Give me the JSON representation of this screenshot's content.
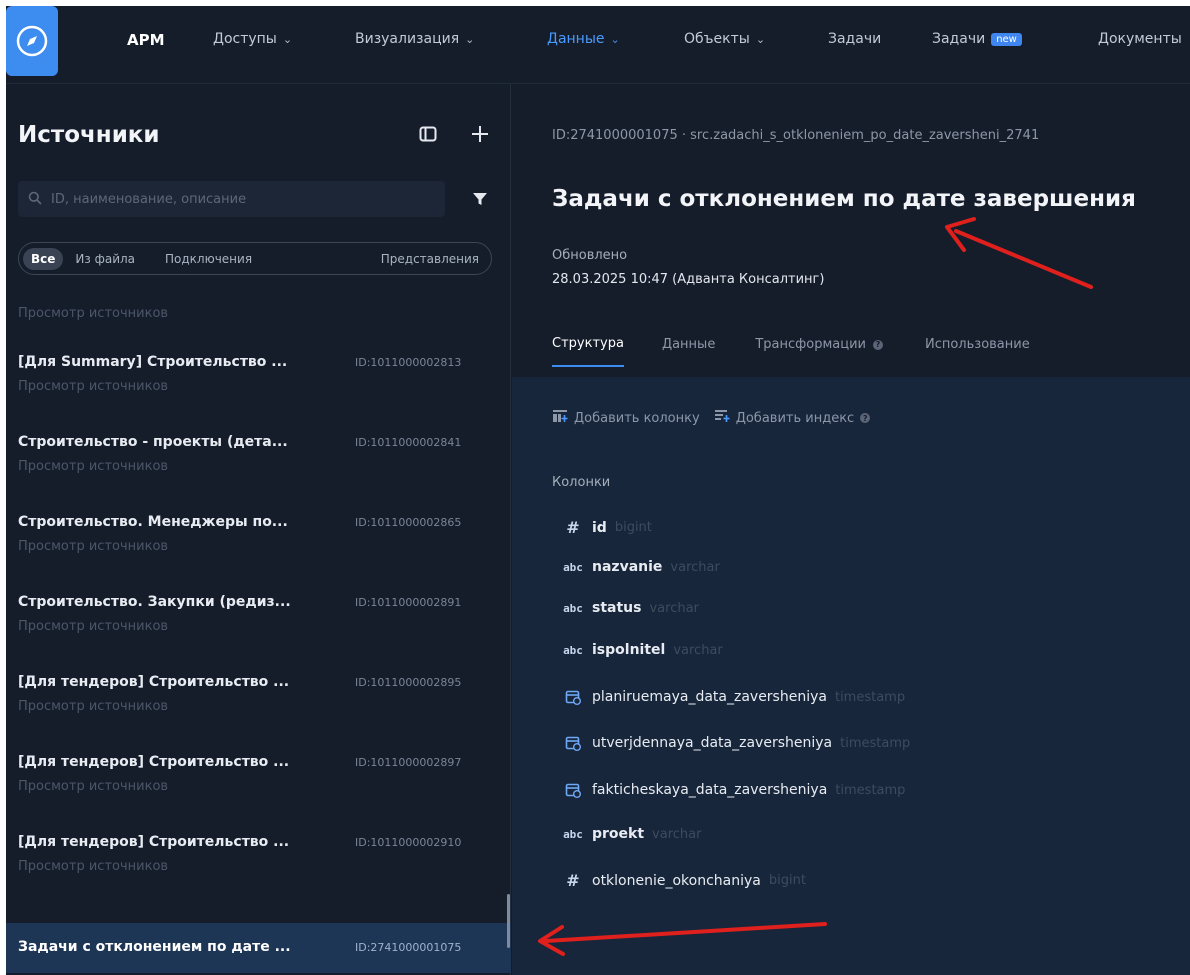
{
  "topnav": {
    "brand": "АРМ",
    "items": [
      {
        "label": "Доступы",
        "chevron": true
      },
      {
        "label": "Визуализация",
        "chevron": true
      },
      {
        "label": "Данные",
        "chevron": true,
        "active": true
      },
      {
        "label": "Объекты",
        "chevron": true
      },
      {
        "label": "Задачи"
      },
      {
        "label": "Задачи",
        "badge": "new"
      },
      {
        "label": "Документы"
      }
    ]
  },
  "sidebar": {
    "title": "Источники",
    "search_placeholder": "ID, наименование, описание",
    "segments": [
      "Все",
      "Из файла",
      "Подключения",
      "Представления"
    ],
    "active_segment": "Все",
    "top_sub": "Просмотр источников",
    "items": [
      {
        "name": "[Для Summary] Строительство ...",
        "id": "ID:1011000002813",
        "sub": "Просмотр источников"
      },
      {
        "name": "Строительство - проекты (дета...",
        "id": "ID:1011000002841",
        "sub": "Просмотр источников"
      },
      {
        "name": "Строительство. Менеджеры по...",
        "id": "ID:1011000002865",
        "sub": "Просмотр источников"
      },
      {
        "name": "Строительство. Закупки (редиз...",
        "id": "ID:1011000002891",
        "sub": "Просмотр источников"
      },
      {
        "name": "[Для тендеров] Строительство ...",
        "id": "ID:1011000002895",
        "sub": "Просмотр источников"
      },
      {
        "name": "[Для тендеров] Строительство ...",
        "id": "ID:1011000002897",
        "sub": "Просмотр источников"
      },
      {
        "name": "[Для тендеров] Строительство ...",
        "id": "ID:1011000002910",
        "sub": "Просмотр источников"
      }
    ],
    "selected": {
      "name": "Задачи с отклонением по дате ...",
      "id": "ID:2741000001075"
    }
  },
  "main": {
    "breadcrumb": "ID:2741000001075 · src.zadachi_s_otkloneniem_po_date_zaversheni_2741",
    "title": "Задачи с отклонением по дате завершения",
    "updated_label": "Обновлено",
    "updated_value": "28.03.2025 10:47 (Адванта Консалтинг)",
    "tabs": [
      {
        "label": "Структура",
        "active": true
      },
      {
        "label": "Данные"
      },
      {
        "label": "Трансформации",
        "help": true
      },
      {
        "label": "Использование"
      }
    ],
    "actions": [
      {
        "label": "Добавить колонку"
      },
      {
        "label": "Добавить индекс",
        "help": true
      }
    ],
    "columns_label": "Колонки",
    "columns": [
      {
        "icon": "hash-icon",
        "name": "id",
        "type": "bigint"
      },
      {
        "icon": "abc-icon",
        "name": "nazvanie",
        "type": "varchar"
      },
      {
        "icon": "abc-icon",
        "name": "status",
        "type": "varchar"
      },
      {
        "icon": "abc-icon",
        "name": "ispolnitel",
        "type": "varchar"
      },
      {
        "icon": "calendar-icon",
        "name": "planiruemaya_data_zaversheniya",
        "type": "timestamp"
      },
      {
        "icon": "calendar-icon",
        "name": "utverjdennaya_data_zaversheniya",
        "type": "timestamp"
      },
      {
        "icon": "calendar-icon",
        "name": "fakticheskaya_data_zaversheniya",
        "type": "timestamp"
      },
      {
        "icon": "abc-icon",
        "name": "proekt",
        "type": "varchar"
      },
      {
        "icon": "hash-icon",
        "name": "otklonenie_okonchaniya",
        "type": "bigint"
      }
    ]
  },
  "colors": {
    "accent": "#3d8cf0",
    "annotation_arrow": "#e0201c",
    "background": "#141c2a",
    "selected_row": "#1e3656"
  }
}
